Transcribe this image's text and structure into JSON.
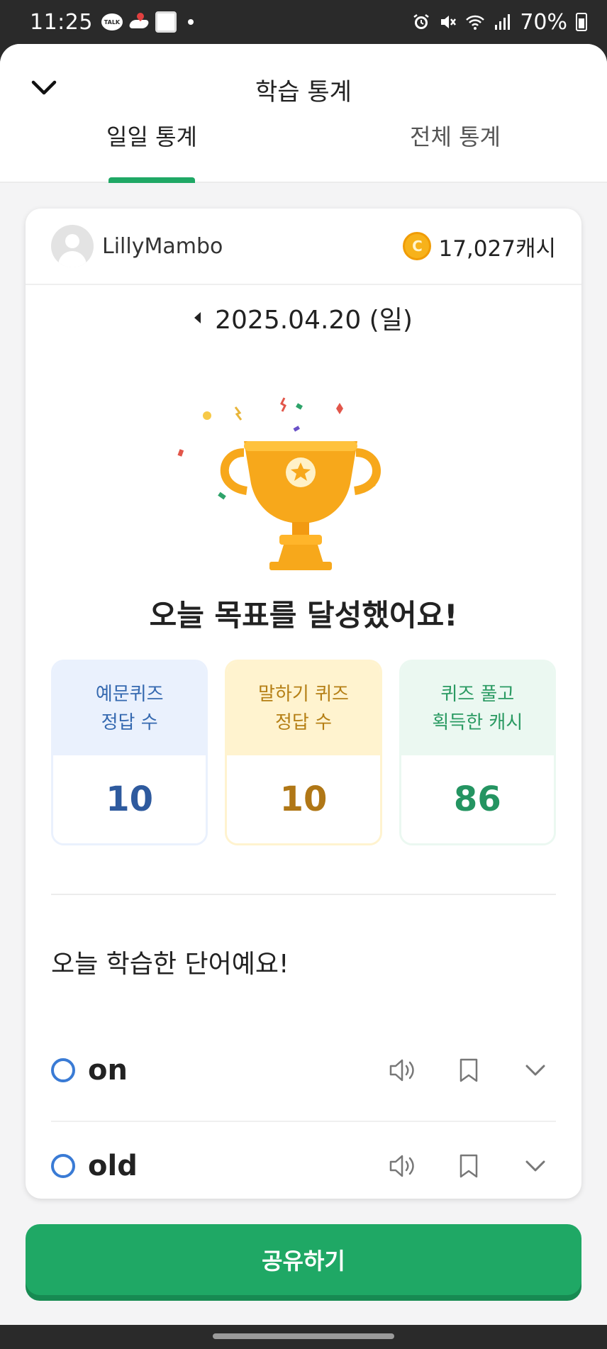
{
  "status_bar": {
    "time": "11:25",
    "talk_label": "TALK",
    "battery": "70%",
    "icons": [
      "kakaotalk-icon",
      "map-icon",
      "qr-icon",
      "alarm-icon",
      "mute-icon",
      "wifi-icon",
      "signal-icon",
      "battery-icon"
    ]
  },
  "header": {
    "title": "학습 통계",
    "tabs": [
      {
        "label": "일일 통계",
        "active": true
      },
      {
        "label": "전체 통계",
        "active": false
      }
    ]
  },
  "profile": {
    "username": "LillyMambo",
    "coin_symbol": "C",
    "cash": "17,027캐시"
  },
  "date": "2025.04.20 (일)",
  "goal_message": "오늘 목표를 달성했어요!",
  "stats": [
    {
      "label": "예문퀴즈\n정답 수",
      "value": "10",
      "color": "#3569b0"
    },
    {
      "label": "말하기 퀴즈\n정답 수",
      "value": "10",
      "color": "#b57f15"
    },
    {
      "label": "퀴즈 풀고\n획득한 캐시",
      "value": "86",
      "color": "#2a9a62"
    }
  ],
  "words_section": {
    "title": "오늘 학습한 단어예요!",
    "words": [
      {
        "word": "on"
      },
      {
        "word": "old"
      }
    ]
  },
  "share_button": "공유하기",
  "colors": {
    "accent": "#1fa865",
    "trophy": "#f7a81b"
  }
}
